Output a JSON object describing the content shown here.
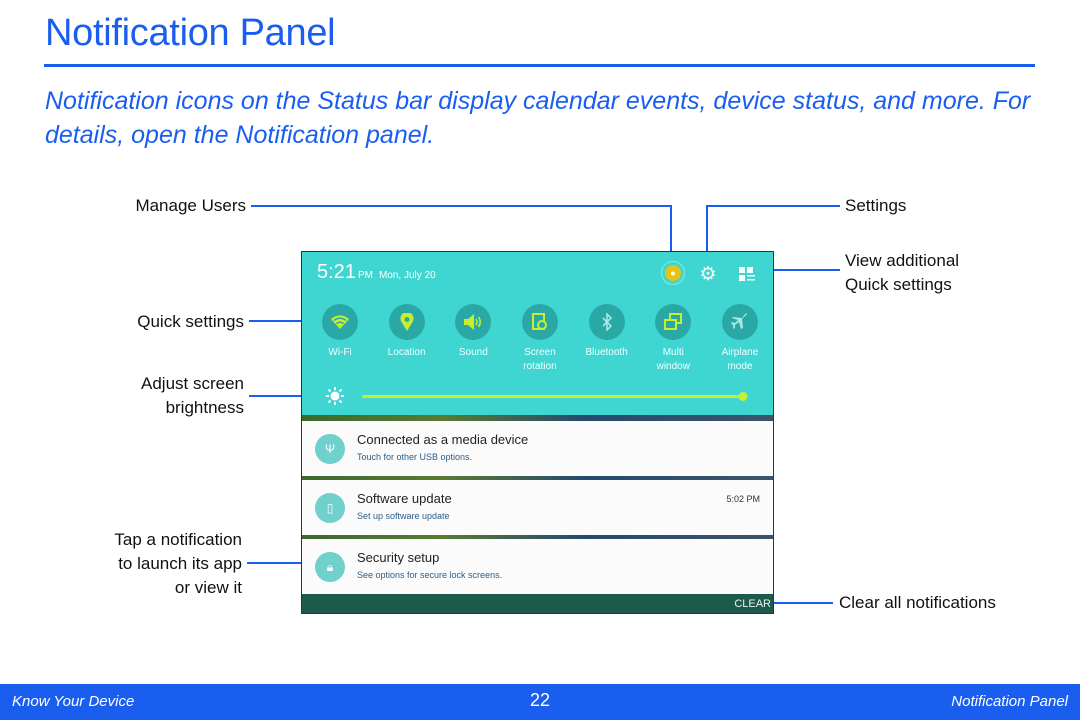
{
  "header": {
    "title": "Notification Panel",
    "intro": "Notification icons on the Status bar display calendar events, device status, and more. For details, open the Notification panel."
  },
  "callouts": {
    "manage_users": "Manage Users",
    "quick_settings": "Quick settings",
    "adjust_brightness_1": "Adjust screen",
    "adjust_brightness_2": "brightness",
    "tap_notification_1": "Tap a notification",
    "tap_notification_2": "to launch its app",
    "tap_notification_3": "or view it",
    "settings": "Settings",
    "view_additional_1": "View additional",
    "view_additional_2": "Quick settings",
    "clear_all": "Clear all notifications"
  },
  "panel": {
    "time": "5:21",
    "ampm": "PM",
    "date": "Mon, July 20",
    "top_icons": [
      "user-avatar-icon",
      "gear-icon",
      "grid-edit-icon"
    ],
    "quick_settings": [
      {
        "label_1": "Wi-Fi",
        "label_2": "",
        "icon": "wifi-icon",
        "active": true
      },
      {
        "label_1": "Location",
        "label_2": "",
        "icon": "location-pin-icon",
        "active": true
      },
      {
        "label_1": "Sound",
        "label_2": "",
        "icon": "speaker-icon",
        "active": true
      },
      {
        "label_1": "Screen",
        "label_2": "rotation",
        "icon": "rotation-icon",
        "active": true
      },
      {
        "label_1": "Bluetooth",
        "label_2": "",
        "icon": "bluetooth-icon",
        "active": false
      },
      {
        "label_1": "Multi",
        "label_2": "window",
        "icon": "multi-window-icon",
        "active": true
      },
      {
        "label_1": "Airplane",
        "label_2": "mode",
        "icon": "airplane-icon",
        "active": false
      }
    ],
    "brightness_percent": 100,
    "notifications": [
      {
        "title": "Connected as a media device",
        "subtitle": "Touch for other USB options.",
        "time": "",
        "icon": "usb-icon"
      },
      {
        "title": "Software update",
        "subtitle": "Set up software update",
        "time": "5:02 PM",
        "icon": "software-update-icon"
      },
      {
        "title": "Security setup",
        "subtitle": "See options for secure lock screens.",
        "time": "",
        "icon": "lock-warning-icon"
      }
    ],
    "clear_label": "CLEAR"
  },
  "colors": {
    "brand_blue": "#1a5ef0",
    "panel_teal": "#3fd6d2",
    "active_green": "#c7ef2f"
  },
  "footer": {
    "left": "Know Your Device",
    "page": "22",
    "right": "Notification Panel"
  }
}
